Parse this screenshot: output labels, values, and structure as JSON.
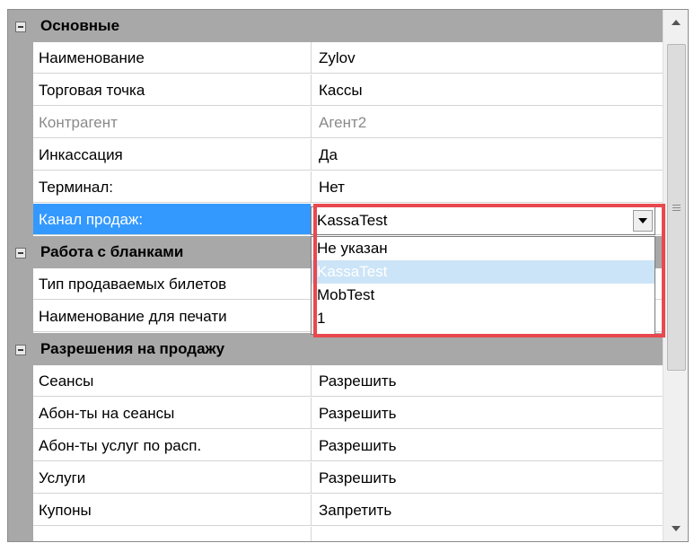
{
  "categories": {
    "main": "Основные",
    "blanks": "Работа с бланками",
    "permissions": "Разрешения на продажу"
  },
  "rows": {
    "name": {
      "label": "Наименование",
      "value": "Zylov"
    },
    "point": {
      "label": "Торговая точка",
      "value": "Кассы"
    },
    "counterparty": {
      "label": "Контрагент",
      "value": "Агент2"
    },
    "collection": {
      "label": "Инкассация",
      "value": "Да"
    },
    "terminal": {
      "label": "Терминал:",
      "value": "Нет"
    },
    "channel": {
      "label": "Канал продаж:",
      "value": "KassaTest"
    },
    "ticket_type": {
      "label": "Тип продаваемых билетов",
      "value": ""
    },
    "print_name": {
      "label": "Наименование для печати",
      "value": ""
    },
    "sessions": {
      "label": "Сеансы",
      "value": "Разрешить"
    },
    "subs_sessions": {
      "label": "Абон-ты на сеансы",
      "value": "Разрешить"
    },
    "subs_services": {
      "label": "Абон-ты услуг по расп.",
      "value": "Разрешить"
    },
    "services": {
      "label": "Услуги",
      "value": "Разрешить"
    },
    "coupons": {
      "label": "Купоны",
      "value": "Запретить"
    }
  },
  "dropdown": {
    "selected": "KassaTest",
    "options": [
      "Не указан",
      "KassaTest",
      "MobTest",
      "1"
    ],
    "highlighted_option": "KassaTest"
  },
  "colors": {
    "category_bg": "#a8a8a8",
    "selection": "#3399ff",
    "option_highlight": "#cce4f7",
    "annotation_border": "#e8484e"
  },
  "icons": {
    "collapse": "minus-box-icon",
    "scroll_up": "triangle-up-icon",
    "scroll_down": "triangle-down-icon",
    "combo_arrow": "chevron-down-icon"
  }
}
